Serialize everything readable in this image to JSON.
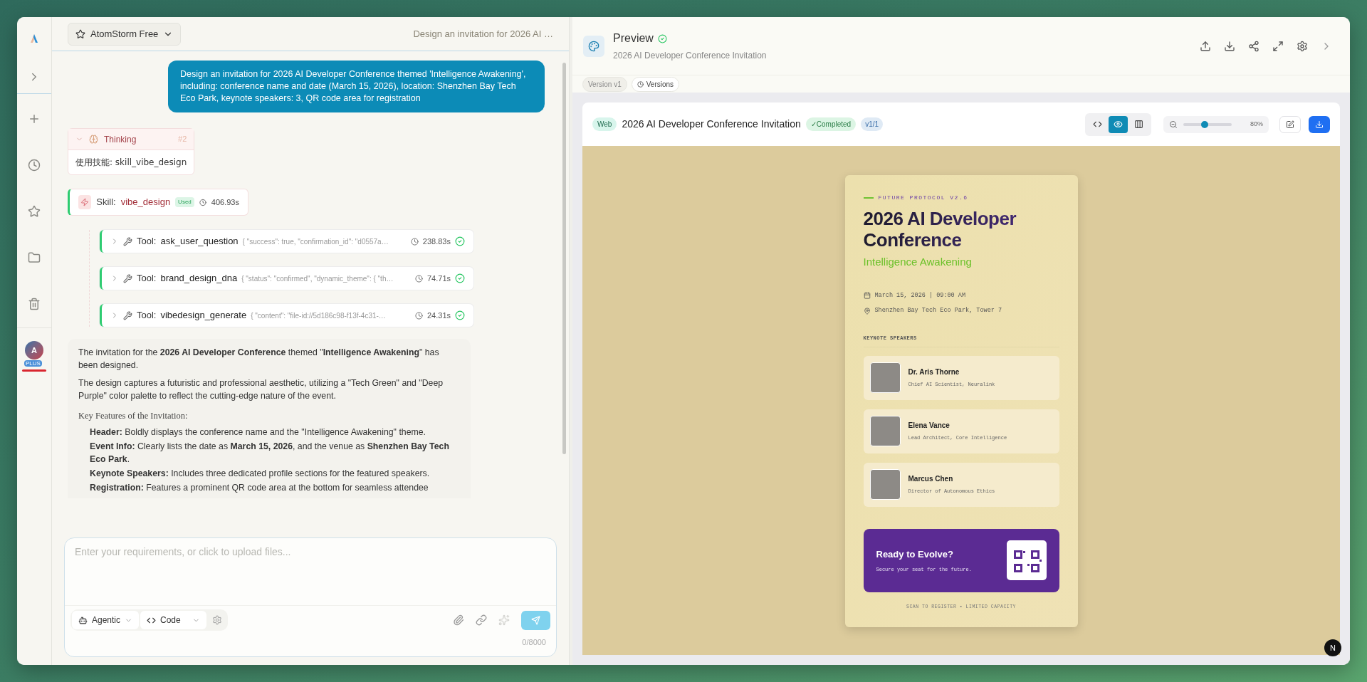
{
  "sidebar": {
    "avatar": {
      "letter": "A",
      "badge": "PLUS"
    }
  },
  "chat": {
    "model_selector": "AtomStorm Free",
    "conversation_title": "Design an invitation for 2026 AI …",
    "user_message": "Design an invitation for 2026 AI Developer Conference themed 'Intelligence Awakening', including: conference name and date (March 15, 2026), location: Shenzhen Bay Tech Eco Park, keynote speakers: 3, QR code area for registration",
    "thinking": {
      "label": "Thinking",
      "number": "#2",
      "content": "使用技能: skill_vibe_design",
      "expanded": true
    },
    "skill": {
      "prefix": "Skill:",
      "name": "vibe_design",
      "badge": "Used",
      "duration": "406.93s"
    },
    "tools": [
      {
        "prefix": "Tool:",
        "name": "ask_user_question",
        "result": "{ \"success\": true, \"confirmation_id\": \"d0557a…",
        "duration": "238.83s",
        "done": true
      },
      {
        "prefix": "Tool:",
        "name": "brand_design_dna",
        "result": "{ \"status\": \"confirmed\", \"dynamic_theme\": { \"th…",
        "duration": "74.71s",
        "done": true
      },
      {
        "prefix": "Tool:",
        "name": "vibedesign_generate",
        "result": "{ \"content\": \"file-id://5d186c98-f13f-4c31-…",
        "duration": "24.31s",
        "done": true
      }
    ],
    "answer": {
      "paragraphs": [
        "The invitation for the **2026 AI Developer Conference** themed \"**Intelligence Awakening**\" has been designed.",
        "The design captures a futuristic and professional aesthetic, utilizing a \"Tech Green\" and \"Deep Purple\" color palette to reflect the cutting-edge nature of the event."
      ],
      "heading": "Key Features of the Invitation:",
      "features": [
        "**Header:** Boldly displays the conference name and the \"Intelligence Awakening\" theme.",
        "**Event Info:** Clearly lists the date as **March 15, 2026**, and the venue as **Shenzhen Bay Tech Eco Park**.",
        "**Keynote Speakers:** Includes three dedicated profile sections for the featured speakers.",
        "**Registration:** Features a prominent QR code area at the bottom for seamless attendee"
      ]
    },
    "composer": {
      "placeholder": "Enter your requirements, or click to upload files...",
      "mode": "Agentic",
      "format": "Code",
      "counter": "0/8000"
    }
  },
  "preview": {
    "title": "Preview",
    "verified": true,
    "subtitle": "2026 AI Developer Conference Invitation",
    "version": "Version v1",
    "versions_button": "Versions",
    "toolbar": {
      "type_badge": "Web",
      "title": "2026 AI Developer Conference Invitation",
      "status": "✓Completed",
      "version": "v1/1",
      "view_modes": [
        {
          "kind": "code",
          "selected": false
        },
        {
          "kind": "preview",
          "selected": true
        },
        {
          "kind": "split",
          "selected": false
        }
      ],
      "zoom": {
        "level": 0.44,
        "reading": "80%"
      }
    },
    "invitation": {
      "eyebrow": "FUTURE PROTOCOL V2.6",
      "title": "2026 AI Developer Conference",
      "theme": "Intelligence Awakening",
      "date": "March 15, 2026 | 09:00 AM",
      "location": "Shenzhen Bay Tech Eco Park, Tower 7",
      "speakers_heading": "KEYNOTE SPEAKERS",
      "speakers": [
        {
          "name": "Dr. Aris Thorne",
          "role": "Chief AI Scientist, Neuralink"
        },
        {
          "name": "Elena Vance",
          "role": "Lead Architect, Core Intelligence"
        },
        {
          "name": "Marcus Chen",
          "role": "Director of Autonomous Ethics"
        }
      ],
      "cta": {
        "title": "Ready to Evolve?",
        "subtitle": "Secure your seat for the future."
      },
      "footer": "SCAN TO REGISTER • LIMITED CAPACITY"
    },
    "dev_badge": "N"
  }
}
